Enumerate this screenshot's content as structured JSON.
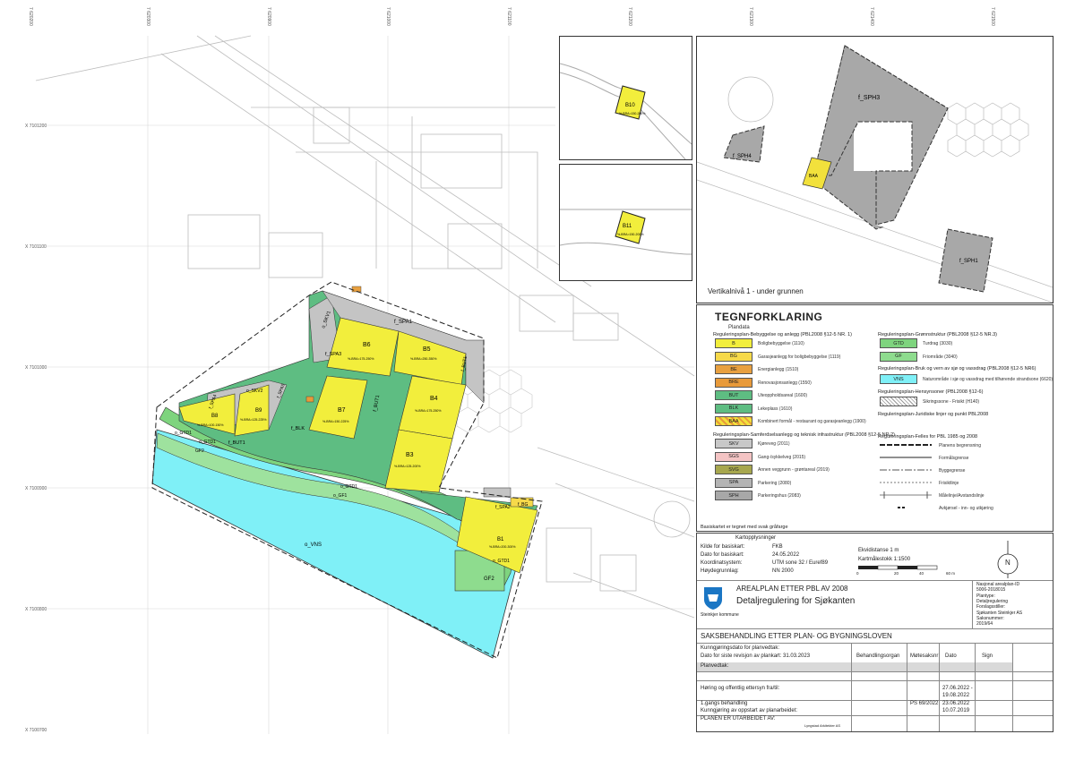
{
  "coords": {
    "x_labels": [
      "7 620200",
      "7 620300",
      "7 620900",
      "7 621000",
      "7 621100",
      "7 621200",
      "7 621300",
      "7 621400",
      "7 621500"
    ],
    "y_labels": [
      "X 7101200",
      "X 7101100",
      "X 7101000",
      "X 7100900",
      "X 7100800",
      "X 7100700"
    ]
  },
  "inset_vertical": {
    "label": "Vertikalnivå 1 - under grunnen"
  },
  "map_labels": {
    "B10": "B10",
    "B10_sub": "%-BRA=150-200%",
    "B11": "B11",
    "B11_sub": "%-BRA=150-200%",
    "SPH3": "f_SPH3",
    "SPH4": "f_SPH4",
    "SPH1": "f_SPH1",
    "BAA": "BAA",
    "SPA1": "f_SPA1",
    "SKV1": "o_SKV1",
    "SPA3": "f_SPA3",
    "SPA4": "f_SPA4",
    "SKV2": "o_SKV2",
    "SPA5": "f_SPA5",
    "B6": "B6",
    "B6_sub": "%-BRA=175-250%",
    "B5": "B5",
    "B5_sub": "%-BRA=250-350%",
    "BUT1": "f_BUT1",
    "BUT1b": "f_BUT1",
    "B7": "B7",
    "B7_sub": "%-BRA=150-225%",
    "B4": "B4",
    "B4_sub": "%-BRA=175-250%",
    "B8": "B8",
    "B8_sub": "%-BRA=100-150%",
    "B9": "B9",
    "B9_sub": "%-BRA=125-225%",
    "BUT2": "f_BUT1",
    "BLK": "f_BLK",
    "B3": "B3",
    "B3_sub": "%-BRA=125-200%",
    "GTD1": "o_GTD1",
    "GTD1b": "o_GTD1",
    "GF2": "GF2",
    "GF1": "o_GF1",
    "GTD3": "o_GTD1",
    "VNS": "o_VNS",
    "SPA2": "f_SPA2",
    "BG": "f_BG",
    "B1": "B1",
    "B1_sub": "%-BRA=200-300%",
    "GF2b": "GF2",
    "GTD2": "o_GTD1"
  },
  "legend": {
    "title": "TEGNFORKLARING",
    "plandata": "Plandata",
    "sec1": "Reguleringsplan-Bebyggelse og anlegg (PBL2008 §12-5 NR. 1)",
    "items1": [
      {
        "code": "B",
        "label": "Boligbebyggelse (1110)",
        "color": "#f2ee3c"
      },
      {
        "code": "BG",
        "label": "Garasjeanlegg for boligbebyggelse (1119)",
        "color": "#f6d94a"
      },
      {
        "code": "BE",
        "label": "Energianlegg (1510)",
        "color": "#e8a040"
      },
      {
        "code": "BRE",
        "label": "Renovasjonsanlegg (1550)",
        "color": "#e89a3a"
      },
      {
        "code": "BUT",
        "label": "Uteoppholdsareal (1600)",
        "color": "#5ebd82"
      },
      {
        "code": "BLK",
        "label": "Lekeplass (1610)",
        "color": "#5ebd82"
      },
      {
        "code": "BAA",
        "label": "Kombinert formål - restaurant og garasjeanlegg (1900)",
        "color": "#f2e13c"
      }
    ],
    "sec2": "Reguleringsplan-Samferdselsanlegg og teknisk infrastruktur (PBL2008 §12-5 NR.2)",
    "items2": [
      {
        "code": "SKV",
        "label": "Kjøreveg (2011)",
        "color": "#c8c8c8"
      },
      {
        "code": "SGS",
        "label": "Gang-/sykkelveg (2015)",
        "color": "#f4c4c4"
      },
      {
        "code": "SVG",
        "label": "Annen veggrunn - grøntareal (2019)",
        "color": "#a7a74e"
      },
      {
        "code": "SPA",
        "label": "Parkering (2080)",
        "color": "#b4b4b4"
      },
      {
        "code": "SPH",
        "label": "Parkeringshus (2083)",
        "color": "#a8a8a8"
      }
    ],
    "sec3": "Reguleringsplan-Grønnstruktur (PBL2008 §12-5 NR.3)",
    "items3": [
      {
        "code": "GTD",
        "label": "Turdrag (3030)",
        "color": "#7ed47e"
      },
      {
        "code": "GF",
        "label": "Friområde (3040)",
        "color": "#8edc8e"
      }
    ],
    "sec4": "Reguleringsplan-Bruk og vern av sjø og vassdrag (PBL2008 §12-5 NR6)",
    "items4": [
      {
        "code": "VNS",
        "label": "Naturområde i sjø og vassdrag med tilhørende strandsone (6620)",
        "color": "#7ff0f7"
      }
    ],
    "sec5": "Reguleringsplan-Hensynsoner (PBL2008 §12-6)",
    "item5": "Sikringssone - Frisikt (H140)",
    "sec6": "Reguleringsplan-Juridiske linjer og punkt PBL2008",
    "sec7": "Reguleringsplan-Felles for PBL 1985 og 2008",
    "lines": [
      "Planens begrensning",
      "Formålsgrense",
      "Byggegrense",
      "Frisiktlinje",
      "Målelinje/Avstandslinje",
      "Avkjørsel - inn- og utkjøring"
    ]
  },
  "title_block": {
    "basis_note": "Basiskartet er tegnet med svak gråfarge",
    "kart_title": "Kartopplysninger",
    "rows": [
      {
        "k": "Kilde for basiskart:",
        "v": "FKB"
      },
      {
        "k": "Dato for basiskart:",
        "v": "24.05.2022"
      },
      {
        "k": "Koordinatsystem:",
        "v": "UTM sone 32 / Euref89"
      },
      {
        "k": "Høydegrunnlag:",
        "v": "NN 2000"
      }
    ],
    "ekvidistanse": "Ekvidistanse    1 m",
    "maalestokk": "Kartmålestokk 1:1500",
    "scale_ticks": [
      "0",
      "20",
      "40",
      "60 m"
    ],
    "north": "N",
    "plan_type_header": "AREALPLAN ETTER PBL AV 2008",
    "plan_name": "Detaljregulering for Sjøkanten",
    "municipality": "Steinkjer kommune",
    "right_info": [
      "Nasjonal arealplan-ID",
      "5006-2018015",
      "Plantype:",
      "Detaljregulering",
      "Forslagsstiller:",
      "Sjøkanten Steinkjer AS",
      "Saksnummer:",
      "2019/64"
    ],
    "saksbehandling": "SAKSBEHANDLING ETTER PLAN- OG BYGNINGSLOVEN",
    "kunngjoring": "Kunngjøringsdato for planvedtak:",
    "revisjon": "Dato for siste revisjon av plankart:   31.03.2023",
    "cols": [
      "Behandlingsorgan",
      "Møtesaksnr",
      "Dato",
      "Sign"
    ],
    "planvedtak": "Planvedtak:",
    "horing": "Høring og offentlig ettersyn fra/til:",
    "horing_dates": [
      "27.06.2022 -",
      "19.08.2022"
    ],
    "gangs": "1.gangs behandling",
    "gangs_nr": "PS 69/2022",
    "gangs_date": "23.06.2022",
    "oppstart": "Kunngjøring av oppstart av planarbeidet:",
    "oppstart_date": "10.07.2019",
    "utarbeidet": "PLANEN ER UTARBEIDET AV:",
    "architect": "Lyngstad Arkitekter AS"
  }
}
